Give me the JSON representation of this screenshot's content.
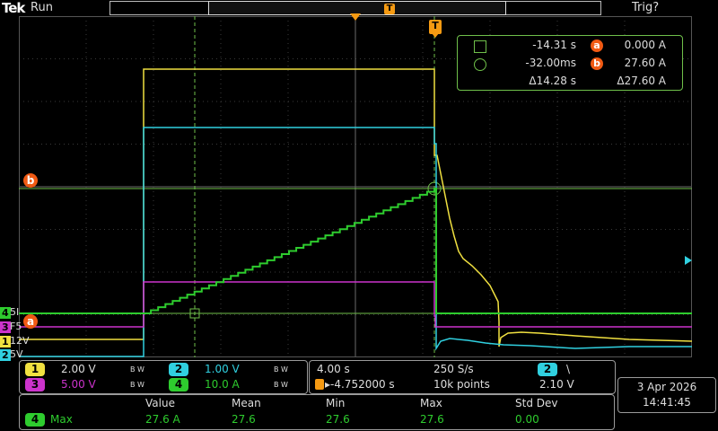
{
  "header": {
    "brand": "Tek",
    "run_state": "Run",
    "trigger_status": "Trig?",
    "record_marker": "T"
  },
  "trigger_marker": "T",
  "cursor_readout": {
    "row1": {
      "time": "-14.31 s",
      "tag": "a",
      "value": "0.000 A"
    },
    "row2": {
      "time": "-32.00ms",
      "tag": "b",
      "value": "27.60 A"
    },
    "row3": {
      "time": "Δ14.28 s",
      "value": "Δ27.60 A"
    }
  },
  "cursor_labels": {
    "b": "b",
    "a": "a"
  },
  "channel_markers": [
    {
      "id": "4",
      "label": "5I",
      "color": "#2ecc2e"
    },
    {
      "id": "3",
      "label": "F5",
      "color": "#cc33cc"
    },
    {
      "id": "1",
      "label": "12V",
      "color": "#f0e040"
    },
    {
      "id": "2",
      "label": "5V",
      "color": "#30d0e0"
    }
  ],
  "channel_settings": [
    {
      "id": "1",
      "scale": "2.00 V",
      "bw": "B W",
      "color": "#f0e040"
    },
    {
      "id": "2",
      "scale": "1.00 V",
      "bw": "B W",
      "color": "#30d0e0"
    },
    {
      "id": "3",
      "scale": "5.00 V",
      "bw": "B W",
      "color": "#cc33cc"
    },
    {
      "id": "4",
      "scale": "10.0 A",
      "bw": "B W",
      "color": "#2ecc2e"
    }
  ],
  "horizontal": {
    "time_per_div": "4.00 s",
    "sample_rate": "250 S/s",
    "trigger_position": "▸-4.752000 s",
    "record_length": "10k points"
  },
  "trigger": {
    "source": "2",
    "slope": "\\",
    "level": "2.10 V"
  },
  "datetime": {
    "date": "3 Apr  2026",
    "time": "14:41:45"
  },
  "measurements": {
    "headers": [
      "Value",
      "Mean",
      "Min",
      "Max",
      "Std Dev"
    ],
    "rows": [
      {
        "channel": "4",
        "name": "Max",
        "values": [
          "27.6 A",
          "27.6",
          "27.6",
          "27.6",
          "0.00"
        ]
      }
    ]
  },
  "colors": {
    "ch1": "#f0e040",
    "ch2": "#30d0e0",
    "ch3": "#cc33cc",
    "ch4": "#2ecc2e",
    "cursor": "#6fc04a",
    "trigger": "#f59a12"
  }
}
